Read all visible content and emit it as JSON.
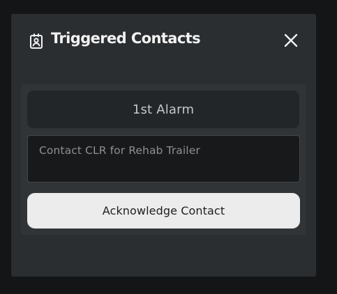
{
  "modal": {
    "title": "Triggered Contacts",
    "title_icon": "contact-badge-icon",
    "close_icon": "close-icon"
  },
  "contact": {
    "alarm_label": "1st Alarm",
    "message": "Contact CLR for Rehab Trailer",
    "acknowledge_label": "Acknowledge Contact"
  },
  "colors": {
    "page_background": "#141516",
    "modal_background": "#2b2e31",
    "panel_background": "#303437",
    "alarm_background": "#232629",
    "message_background": "#17191b",
    "button_background": "#ececec"
  }
}
